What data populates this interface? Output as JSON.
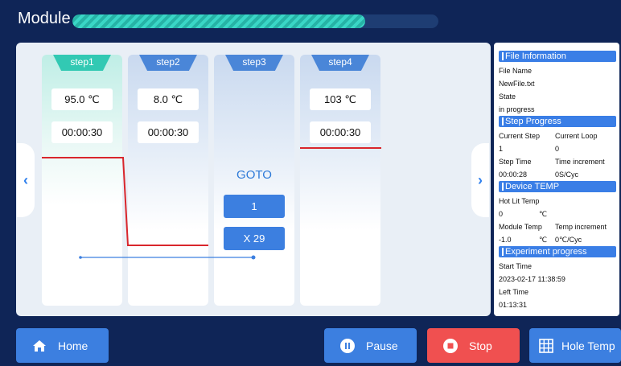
{
  "header": {
    "title": "Module",
    "progress_fraction": 0.8
  },
  "steps": [
    {
      "label": "step1",
      "temp": "95.0 ℃",
      "time": "00:00:30"
    },
    {
      "label": "step2",
      "temp": "8.0 ℃",
      "time": "00:00:30"
    },
    {
      "label": "step3",
      "goto_label": "GOTO",
      "goto_target": "1",
      "goto_repeat": "X 29"
    },
    {
      "label": "step4",
      "temp": "103 ℃",
      "time": "00:00:30"
    }
  ],
  "nav": {
    "prev_icon": "chevron-left-icon",
    "next_icon": "chevron-right-icon"
  },
  "sidebar": {
    "file_info": {
      "title": "File Information",
      "file_name_label": "File Name",
      "file_name": "NewFile.txt",
      "state_label": "State",
      "state": "in progress"
    },
    "step_progress": {
      "title": "Step Progress",
      "current_step_label": "Current Step",
      "current_loop_label": "Current Loop",
      "current_step": "1",
      "current_loop": "0",
      "step_time_label": "Step Time",
      "time_increment_label": "Time increment",
      "step_time": "00:00:28",
      "time_increment": "0S/Cyc"
    },
    "device_temp": {
      "title": "Device TEMP",
      "hot_lit_label": "Hot Lit Temp",
      "hot_lit_value": "0",
      "hot_lit_unit": "℃",
      "module_temp_label": "Module Temp",
      "temp_increment_label": "Temp increment",
      "module_temp_value": "-1.0",
      "module_temp_unit": "℃",
      "temp_increment": "0℃/Cyc"
    },
    "experiment_progress": {
      "title": "Experiment progress",
      "start_time_label": "Start Time",
      "start_time": "2023-02-17 11:38:59",
      "left_time_label": "Left Time",
      "left_time": "01:13:31"
    }
  },
  "buttons": {
    "home": "Home",
    "pause": "Pause",
    "stop": "Stop",
    "hole_temp": "Hole Temp"
  },
  "colors": {
    "background": "#0f2557",
    "accent_blue": "#3c7fe0",
    "stop_red": "#f05050",
    "teal": "#32c9b3",
    "profile_line": "#d9262c"
  }
}
